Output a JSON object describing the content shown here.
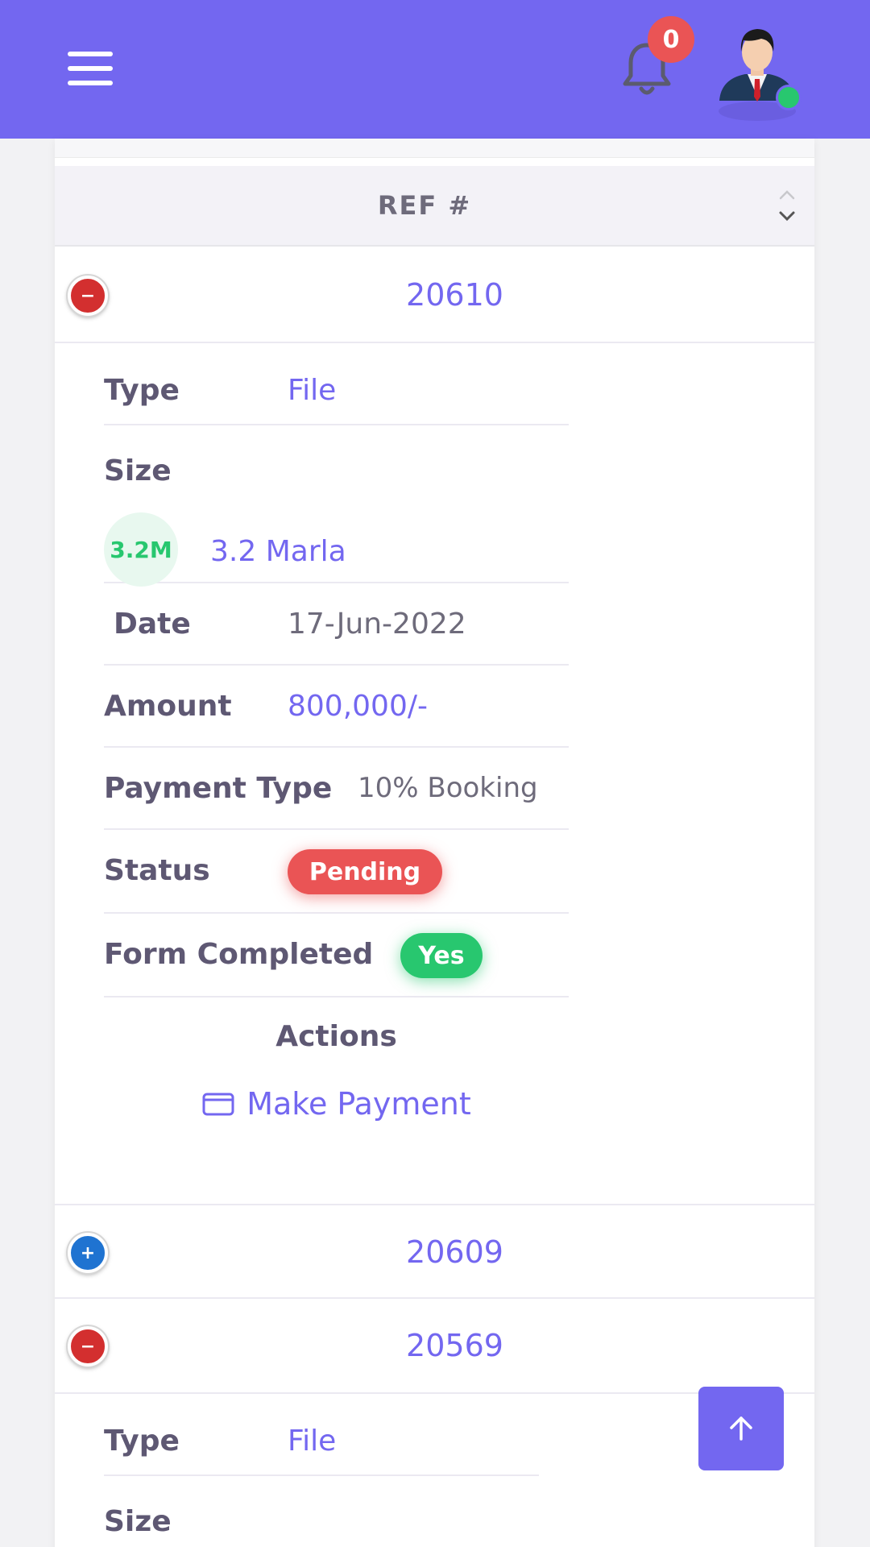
{
  "header": {
    "notification_count": "0",
    "colors": {
      "bar": "#7367f0",
      "badge": "#ea5455",
      "online": "#28c76f"
    }
  },
  "table": {
    "column_header": "REF #"
  },
  "rows": [
    {
      "ref": "20610",
      "expanded": true,
      "details": {
        "type_label": "Type",
        "type_value": "File",
        "size_label": "Size",
        "size_avatar": "3.2M",
        "size_value": "3.2 Marla",
        "date_label": "Date",
        "date_value": "17-Jun-2022",
        "amount_label": "Amount",
        "amount_value": "800,000/-",
        "payment_type_label": "Payment Type",
        "payment_type_value": "10% Booking",
        "status_label": "Status",
        "status_value": "Pending",
        "form_label": "Form Completed",
        "form_value": "Yes",
        "actions_label": "Actions",
        "action_make_payment": "Make Payment"
      }
    },
    {
      "ref": "20609",
      "expanded": false
    },
    {
      "ref": "20569",
      "expanded": true,
      "details": {
        "type_label": "Type",
        "type_value": "File",
        "size_label": "Size"
      }
    }
  ]
}
